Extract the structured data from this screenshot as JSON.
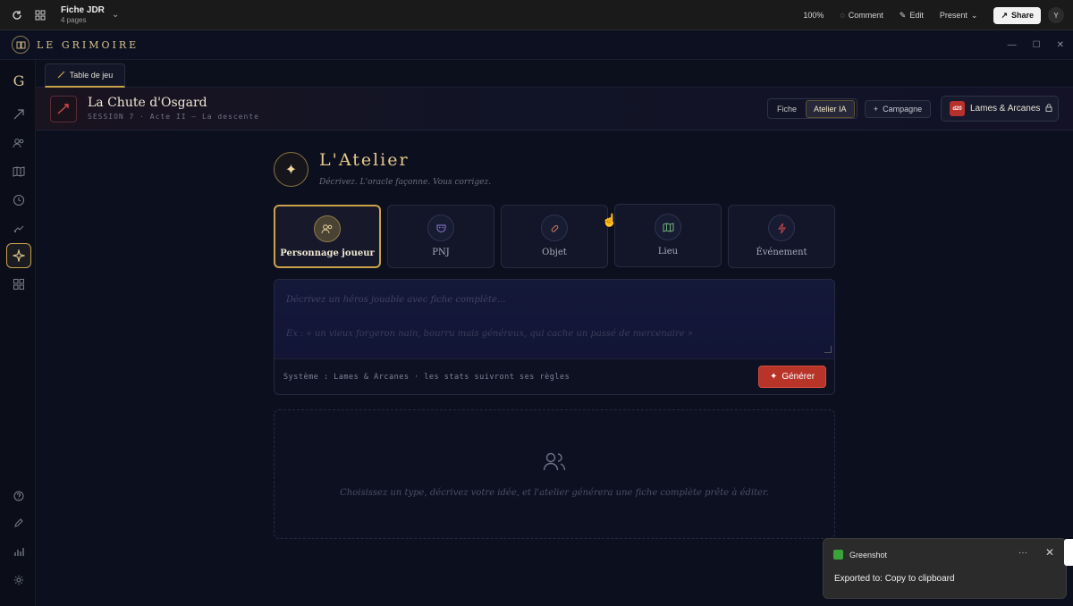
{
  "app_bar": {
    "doc_title": "Fiche JDR",
    "doc_subtitle": "4 pages",
    "zoom": "100%",
    "comment_label": "Comment",
    "edit_label": "Edit",
    "present_label": "Present",
    "share_label": "Share",
    "avatar_initial": "Y"
  },
  "window": {
    "brand": "LE GRIMOIRE",
    "rail_logo": "G"
  },
  "tabs": [
    {
      "label": "Table de jeu"
    }
  ],
  "header": {
    "title": "La Chute d'Osgard",
    "subtitle": "SESSION 7 · Acte II — La descente",
    "segments": [
      "Fiche",
      "Atelier IA"
    ],
    "active_segment": "Atelier IA",
    "campaign_label": "Campagne",
    "system_badge": "d20",
    "system_name": "Lames & Arcanes"
  },
  "atelier": {
    "title": "L'Atelier",
    "subtitle": "Décrivez. L'oracle façonne. Vous corrigez.",
    "types": [
      {
        "label": "Personnage joueur",
        "icon": "users-icon",
        "selected": true
      },
      {
        "label": "PNJ",
        "icon": "mask-icon",
        "selected": false
      },
      {
        "label": "Objet",
        "icon": "pill-icon",
        "selected": false
      },
      {
        "label": "Lieu",
        "icon": "map-icon",
        "selected": false
      },
      {
        "label": "Événement",
        "icon": "bolt-icon",
        "selected": false
      }
    ],
    "prompt_placeholder": "Décrivez un héros jouable avec fiche complète...",
    "prompt_example": "Ex : « un vieux forgeron nain, bourru mais généreux, qui cache un passé de mercenaire »",
    "system_note": "Système : Lames & Arcanes · les stats suivront ses règles",
    "generate_label": "Générer",
    "empty_text": "Choisissez un type, décrivez votre idée, et l'atelier générera une fiche complète prête à éditer."
  },
  "toast": {
    "app_name": "Greenshot",
    "message": "Exported to: Copy to clipboard"
  },
  "colors": {
    "accent_gold": "#c9a24a",
    "generate_red": "#b83328",
    "background": "#0c0f1e"
  }
}
